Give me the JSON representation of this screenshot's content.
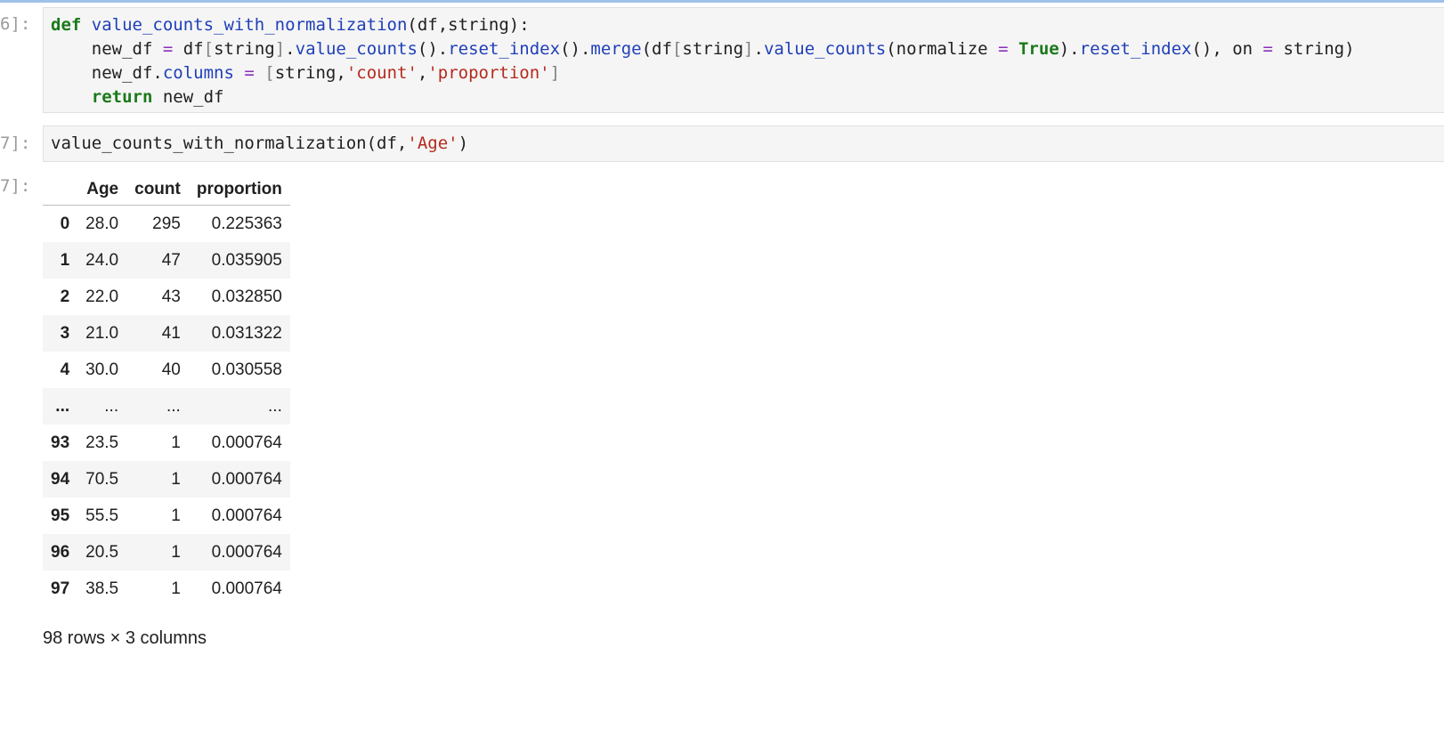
{
  "cells": [
    {
      "prompt": "6]:",
      "code_lines": [
        [
          {
            "t": "def",
            "c": "kw"
          },
          {
            "t": " "
          },
          {
            "t": "value_counts_with_normalization",
            "c": "fn"
          },
          {
            "t": "(df,string):"
          }
        ],
        [
          {
            "t": "    new_df "
          },
          {
            "t": "=",
            "c": "op"
          },
          {
            "t": " df"
          },
          {
            "t": "[",
            "c": "br"
          },
          {
            "t": "string"
          },
          {
            "t": "]",
            "c": "br"
          },
          {
            "t": "."
          },
          {
            "t": "value_counts",
            "c": "at"
          },
          {
            "t": "()."
          },
          {
            "t": "reset_index",
            "c": "at"
          },
          {
            "t": "()."
          },
          {
            "t": "merge",
            "c": "at"
          },
          {
            "t": "(df"
          },
          {
            "t": "[",
            "c": "br"
          },
          {
            "t": "string"
          },
          {
            "t": "]",
            "c": "br"
          },
          {
            "t": "."
          },
          {
            "t": "value_counts",
            "c": "at"
          },
          {
            "t": "(normalize "
          },
          {
            "t": "=",
            "c": "op"
          },
          {
            "t": " "
          },
          {
            "t": "True",
            "c": "bi"
          },
          {
            "t": ")."
          },
          {
            "t": "reset_index",
            "c": "at"
          },
          {
            "t": "(), on "
          },
          {
            "t": "=",
            "c": "op"
          },
          {
            "t": " string)"
          }
        ],
        [
          {
            "t": "    new_df."
          },
          {
            "t": "columns",
            "c": "at"
          },
          {
            "t": " "
          },
          {
            "t": "=",
            "c": "op"
          },
          {
            "t": " "
          },
          {
            "t": "[",
            "c": "br"
          },
          {
            "t": "string,"
          },
          {
            "t": "'count'",
            "c": "st"
          },
          {
            "t": ","
          },
          {
            "t": "'proportion'",
            "c": "st"
          },
          {
            "t": "]",
            "c": "br"
          }
        ],
        [
          {
            "t": "    "
          },
          {
            "t": "return",
            "c": "kw"
          },
          {
            "t": " new_df"
          }
        ]
      ]
    },
    {
      "prompt": "7]:",
      "code_lines": [
        [
          {
            "t": "value_counts_with_normalization(df,"
          },
          {
            "t": "'Age'",
            "c": "st"
          },
          {
            "t": ")"
          }
        ]
      ]
    }
  ],
  "output": {
    "prompt": "7]:",
    "columns": [
      "",
      "Age",
      "count",
      "proportion"
    ],
    "rows": [
      {
        "idx": "0",
        "age": "28.0",
        "count": "295",
        "prop": "0.225363"
      },
      {
        "idx": "1",
        "age": "24.0",
        "count": "47",
        "prop": "0.035905"
      },
      {
        "idx": "2",
        "age": "22.0",
        "count": "43",
        "prop": "0.032850"
      },
      {
        "idx": "3",
        "age": "21.0",
        "count": "41",
        "prop": "0.031322"
      },
      {
        "idx": "4",
        "age": "30.0",
        "count": "40",
        "prop": "0.030558"
      },
      {
        "idx": "...",
        "age": "...",
        "count": "...",
        "prop": "..."
      },
      {
        "idx": "93",
        "age": "23.5",
        "count": "1",
        "prop": "0.000764"
      },
      {
        "idx": "94",
        "age": "70.5",
        "count": "1",
        "prop": "0.000764"
      },
      {
        "idx": "95",
        "age": "55.5",
        "count": "1",
        "prop": "0.000764"
      },
      {
        "idx": "96",
        "age": "20.5",
        "count": "1",
        "prop": "0.000764"
      },
      {
        "idx": "97",
        "age": "38.5",
        "count": "1",
        "prop": "0.000764"
      }
    ],
    "shape_text": "98 rows × 3 columns"
  }
}
